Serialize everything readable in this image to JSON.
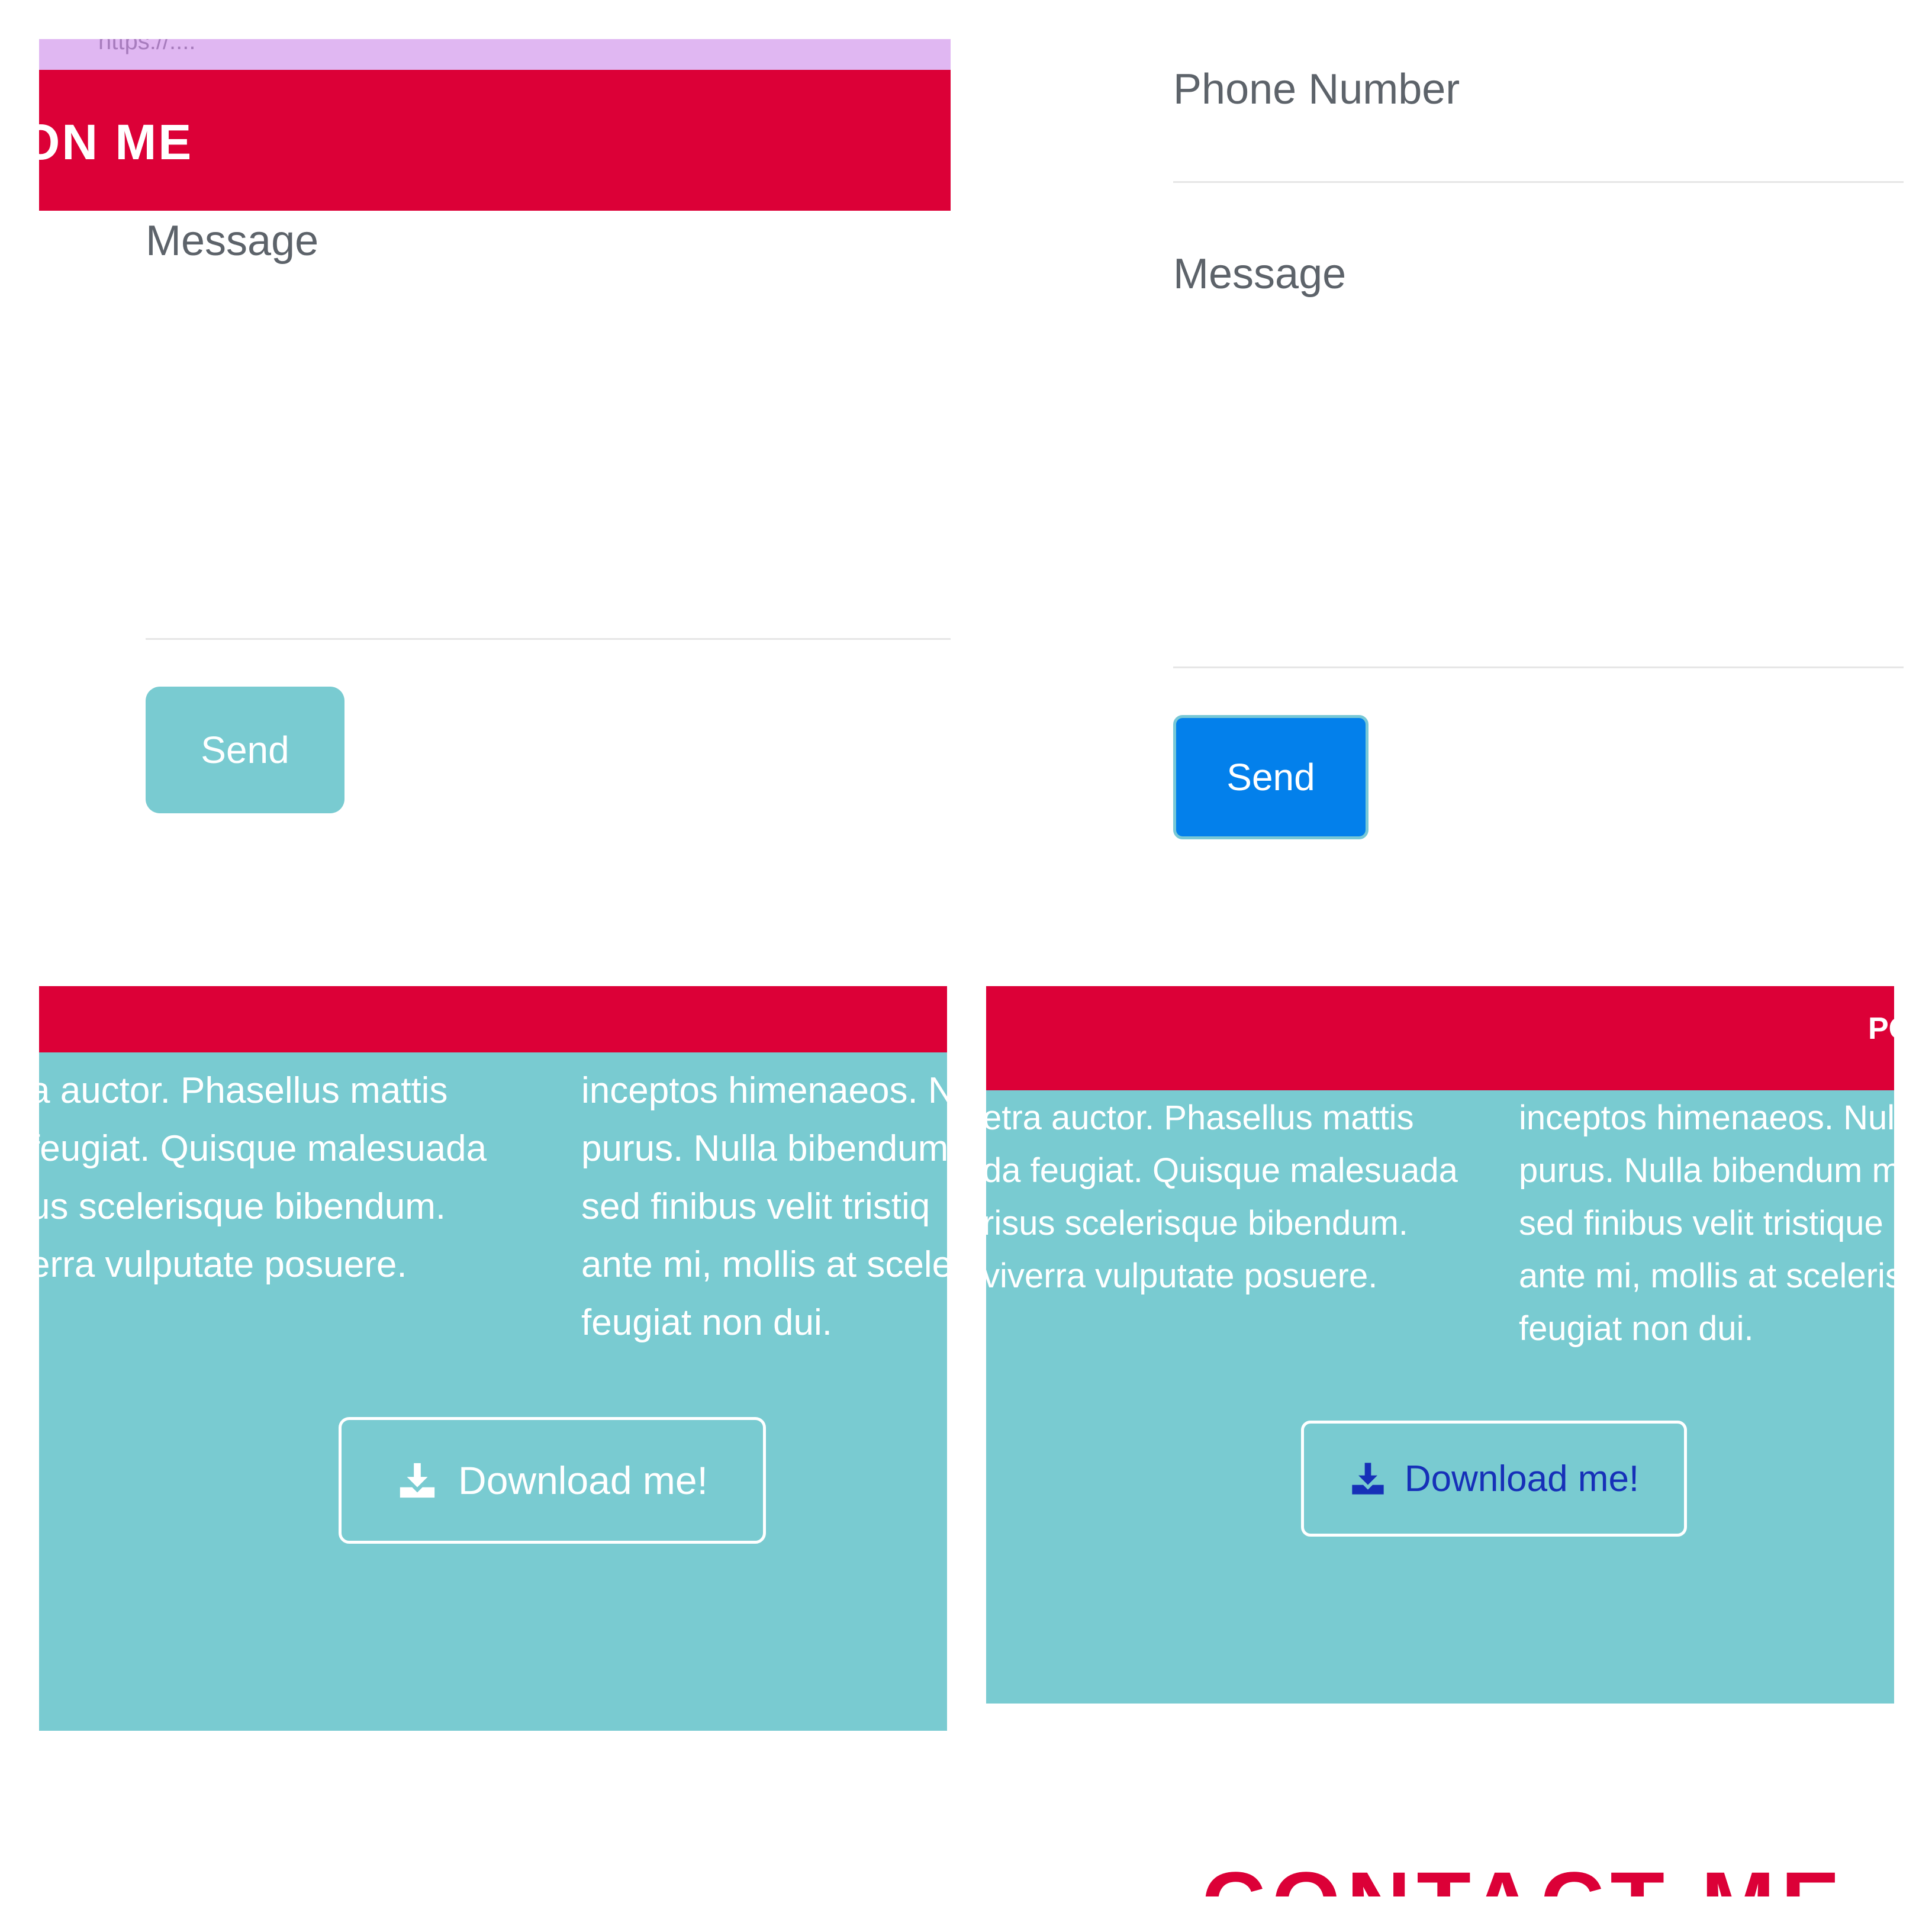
{
  "colors": {
    "primary_red": "#dc0037",
    "teal": "#79cbd1",
    "send_blue": "#0380eb",
    "download_blue_text": "#1630b8",
    "url_bar": "#e0b7f2"
  },
  "panel_left_top": {
    "url_fragment": "https://....",
    "header_title": "ON ME",
    "message_label": "Message",
    "send_label": "Send"
  },
  "panel_right_top": {
    "phone_label": "Phone Number",
    "message_label": "Message",
    "send_label": "Send"
  },
  "panel_left_bottom": {
    "col1_lines": [
      "a auctor. Phasellus mattis",
      "feugiat. Quisque malesuada",
      "us scelerisque bibendum.",
      "erra vulputate posuere."
    ],
    "col2_lines": [
      "inceptos himenaeos. N",
      "purus. Nulla bibendum",
      "sed finibus velit tristiq",
      "ante mi, mollis at scele",
      "feugiat non dui."
    ],
    "download_label": "Download me!",
    "download_icon": "download-icon"
  },
  "panel_right_bottom": {
    "header_fragment": "PO",
    "col1_lines": [
      "etra auctor. Phasellus mattis",
      "da feugiat. Quisque malesuada",
      "risus scelerisque bibendum.",
      "viverra vulputate posuere."
    ],
    "col2_lines": [
      "inceptos himenaeos. Nul",
      "purus. Nulla bibendum m",
      "sed finibus velit tristique",
      "ante mi, mollis at sceleris",
      "feugiat non dui."
    ],
    "download_label": "Download me!",
    "download_icon": "download-icon"
  },
  "footer_heading": "CONTACT ME"
}
